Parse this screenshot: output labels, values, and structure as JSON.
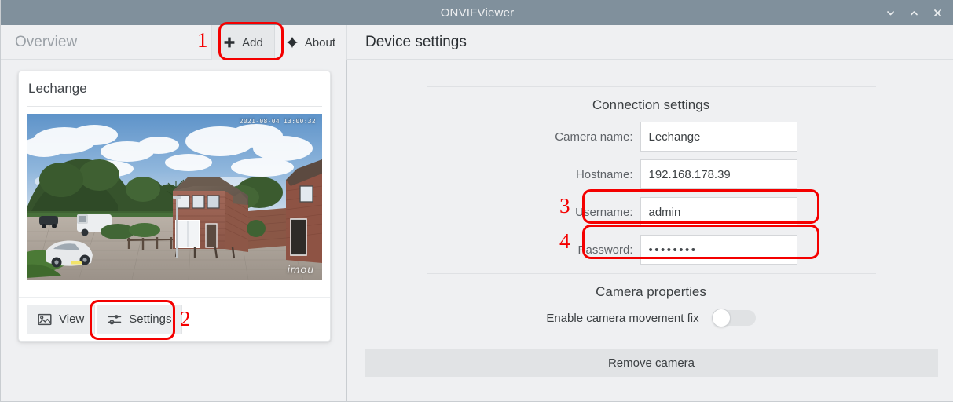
{
  "window": {
    "title": "ONVIFViewer",
    "controls": [
      {
        "name": "minimize",
        "icon": "chevron-down-icon"
      },
      {
        "name": "maximize",
        "icon": "chevron-up-icon"
      },
      {
        "name": "close",
        "icon": "close-icon"
      }
    ]
  },
  "header": {
    "overview_label": "Overview",
    "add_button": {
      "label": "Add",
      "icon": "plus-icon"
    },
    "about_button": {
      "label": "About",
      "icon": "star-diamond-icon"
    },
    "device_settings_title": "Device settings"
  },
  "camera_card": {
    "title": "Lechange",
    "preview": {
      "timestamp": "2021-08-04 13:00:32",
      "watermark": "imou",
      "alt": "camera-snapshot-house-driveway"
    },
    "view_button": {
      "label": "View",
      "icon": "image-icon"
    },
    "settings_button": {
      "label": "Settings",
      "icon": "sliders-icon"
    }
  },
  "device_settings": {
    "connection_heading": "Connection settings",
    "fields": [
      {
        "label": "Camera name:",
        "value": "Lechange",
        "name": "camera-name"
      },
      {
        "label": "Hostname:",
        "value": "192.168.178.39",
        "name": "hostname"
      },
      {
        "label": "Username:",
        "value": "admin",
        "name": "username"
      },
      {
        "label": "Password:",
        "value": "••••••••",
        "name": "password"
      }
    ],
    "properties_heading": "Camera properties",
    "movement_fix": {
      "label": "Enable camera movement fix",
      "state": "off"
    },
    "remove_button": "Remove camera"
  },
  "annotations": [
    {
      "number": "1",
      "target": "add-button"
    },
    {
      "number": "2",
      "target": "settings-button"
    },
    {
      "number": "3",
      "target": "username-field"
    },
    {
      "number": "4",
      "target": "password-field"
    }
  ],
  "colors": {
    "titlebar": "#80909c",
    "app_background": "#eff0f2",
    "annotation_red": "#f40000",
    "card_background": "#ffffff"
  }
}
